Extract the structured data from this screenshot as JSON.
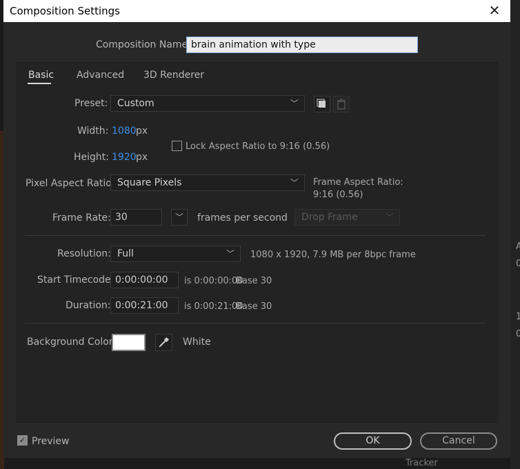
{
  "window": {
    "title": "Composition Settings"
  },
  "composition": {
    "name_label": "Composition Name:",
    "name_value": "brain animation with type"
  },
  "tabs": [
    {
      "label": "Basic",
      "active": true
    },
    {
      "label": "Advanced",
      "active": false
    },
    {
      "label": "3D Renderer",
      "active": false
    }
  ],
  "preset": {
    "label": "Preset:",
    "value": "Custom"
  },
  "width": {
    "label": "Width:",
    "value": "1080",
    "unit": "px"
  },
  "height": {
    "label": "Height:",
    "value": "1920",
    "unit": "px"
  },
  "lock_aspect": {
    "label": "Lock Aspect Ratio to 9:16 (0.56)",
    "checked": false
  },
  "pixel_aspect": {
    "label": "Pixel Aspect Ratio:",
    "value": "Square Pixels"
  },
  "frame_aspect": {
    "label": "Frame Aspect Ratio:",
    "value": "9:16 (0.56)"
  },
  "frame_rate": {
    "label": "Frame Rate:",
    "value": "30",
    "unit": "frames per second",
    "drop_frame": "Drop Frame"
  },
  "resolution": {
    "label": "Resolution:",
    "value": "Full",
    "info": "1080 x 1920, 7.9 MB per 8bpc frame"
  },
  "start_timecode": {
    "label": "Start Timecode:",
    "value": "0:00:00:00",
    "is": "is 0:00:00:00",
    "base": "Base 30"
  },
  "duration": {
    "label": "Duration:",
    "value": "0:00:21:00",
    "is": "is 0:00:21:00",
    "base": "Base 30"
  },
  "background": {
    "label": "Background Color:",
    "color_name": "White",
    "color": "#ffffff"
  },
  "footer": {
    "preview_label": "Preview",
    "preview_checked": true,
    "ok_label": "OK",
    "cancel_label": "Cancel"
  },
  "background_app": {
    "tracker_label": "Tracker",
    "right_labels": [
      "A",
      "0",
      "1",
      "0"
    ]
  },
  "colors": {
    "accent_value": "#3f8ee8",
    "dialog_bg": "#282828"
  }
}
